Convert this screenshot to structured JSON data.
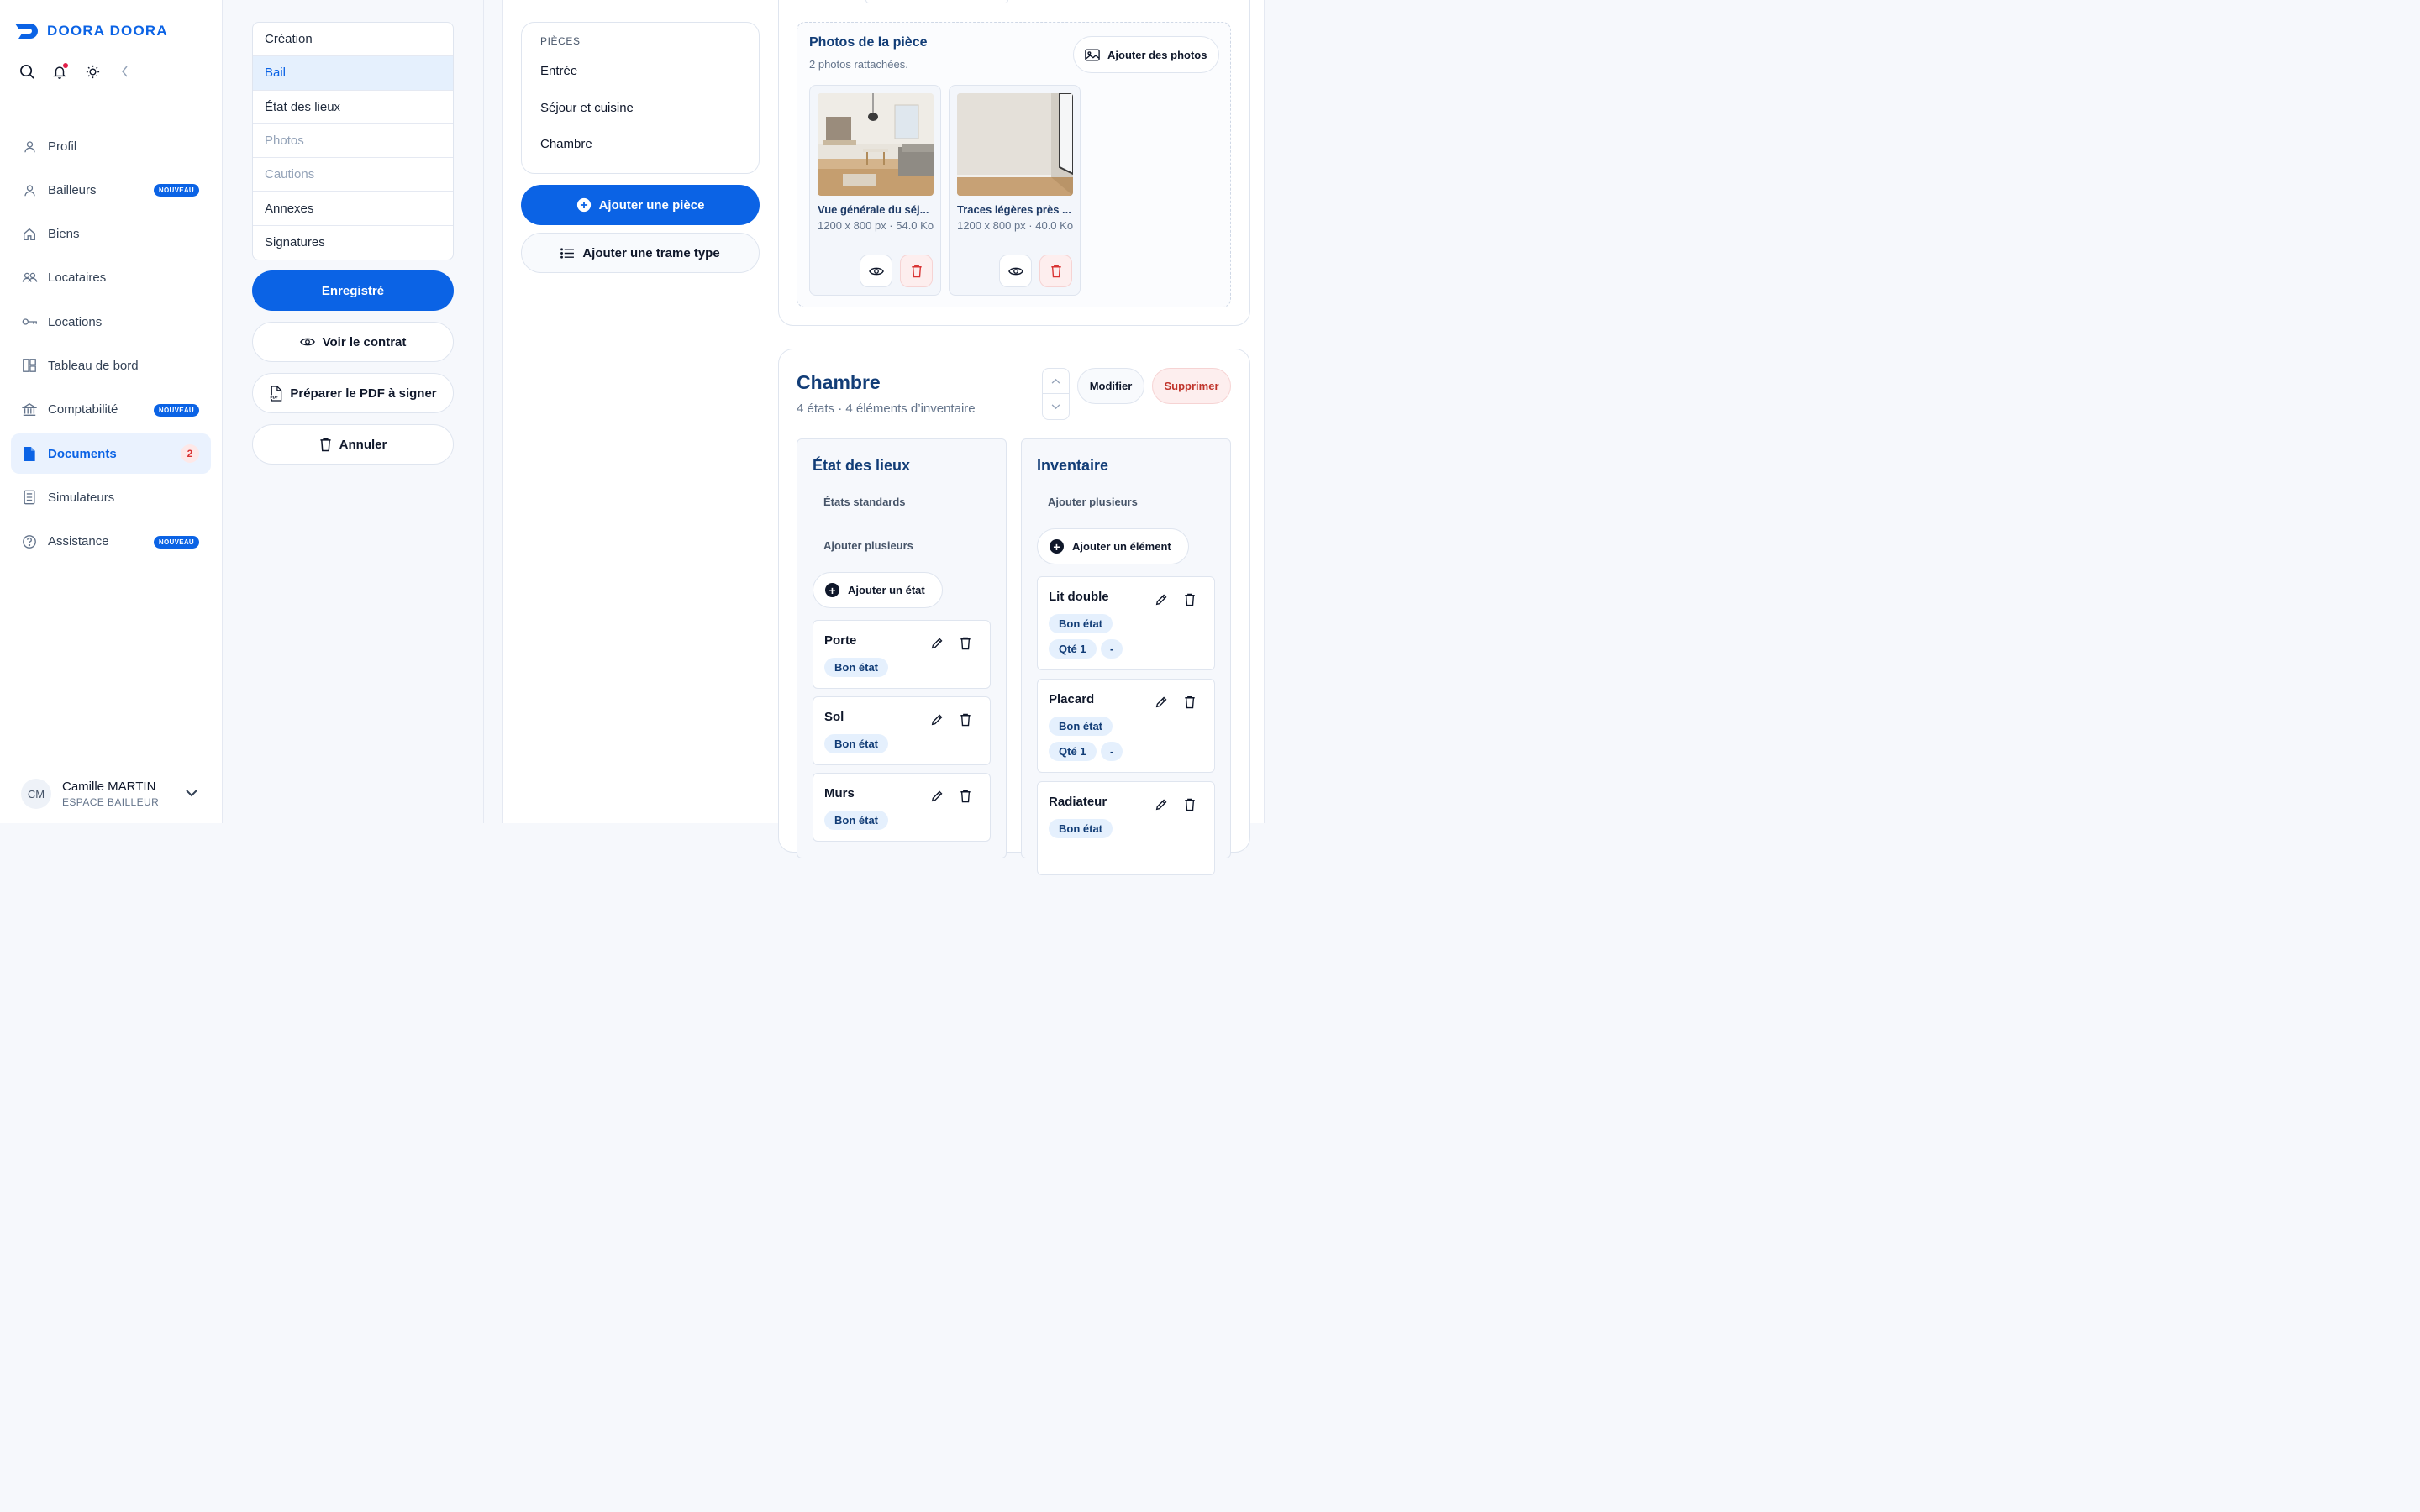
{
  "brand": {
    "name": "DOORA DOORA",
    "color": "#0b63e5"
  },
  "sidebar": {
    "top_icons": [
      "search-icon",
      "bell-icon",
      "sun-icon",
      "chevron-left-icon"
    ],
    "items": [
      {
        "label": "Profil",
        "icon": "user-icon"
      },
      {
        "label": "Bailleurs",
        "icon": "user-icon",
        "badge": "NOUVEAU"
      },
      {
        "label": "Biens",
        "icon": "home-icon"
      },
      {
        "label": "Locataires",
        "icon": "users-icon"
      },
      {
        "label": "Locations",
        "icon": "key-icon"
      },
      {
        "label": "Tableau de bord",
        "icon": "dashboard-icon"
      },
      {
        "label": "Comptabilité",
        "icon": "bank-icon",
        "badge": "NOUVEAU"
      },
      {
        "label": "Documents",
        "icon": "document-icon",
        "count": "2",
        "active": true
      },
      {
        "label": "Simulateurs",
        "icon": "calculator-icon"
      },
      {
        "label": "Assistance",
        "icon": "help-icon",
        "badge": "NOUVEAU"
      }
    ],
    "user": {
      "initials": "CM",
      "name": "Camille MARTIN",
      "role": "ESPACE BAILLEUR"
    }
  },
  "steps": [
    {
      "label": "Création"
    },
    {
      "label": "Bail",
      "active": true
    },
    {
      "label": "État des lieux"
    },
    {
      "label": "Photos",
      "disabled": true
    },
    {
      "label": "Cautions",
      "disabled": true
    },
    {
      "label": "Annexes"
    },
    {
      "label": "Signatures"
    }
  ],
  "actions": {
    "saved": "Enregistré",
    "view_contract": "Voir le contrat",
    "prepare_pdf": "Préparer le PDF à signer",
    "cancel": "Annuler"
  },
  "pieces": {
    "label": "PIÈCES",
    "items": [
      "Entrée",
      "Séjour et cuisine",
      "Chambre"
    ],
    "add_room": "Ajouter une pièce",
    "add_template": "Ajouter une trame type"
  },
  "photos": {
    "title": "Photos de la pièce",
    "subtitle": "2 photos rattachées.",
    "add_button": "Ajouter des photos",
    "items": [
      {
        "title": "Vue générale du séj...",
        "meta": "1200 x 800 px · 54.0 Ko"
      },
      {
        "title": "Traces légères près ...",
        "meta": "1200 x 800 px · 40.0 Ko"
      }
    ]
  },
  "room": {
    "title": "Chambre",
    "summary": "4 états · 4 éléments d’inventaire",
    "edit": "Modifier",
    "delete": "Supprimer",
    "etat": {
      "title": "État des lieux",
      "standard": "États standards",
      "add_multiple": "Ajouter plusieurs",
      "add_one": "Ajouter un état",
      "items": [
        {
          "name": "Porte",
          "state": "Bon état"
        },
        {
          "name": "Sol",
          "state": "Bon état"
        },
        {
          "name": "Murs",
          "state": "Bon état"
        }
      ]
    },
    "inventaire": {
      "title": "Inventaire",
      "add_multiple": "Ajouter plusieurs",
      "add_one": "Ajouter un élément",
      "items": [
        {
          "name": "Lit double",
          "state": "Bon état",
          "qty": "Qté 1",
          "extra": "-"
        },
        {
          "name": "Placard",
          "state": "Bon état",
          "qty": "Qté 1",
          "extra": "-"
        },
        {
          "name": "Radiateur",
          "state": "Bon état"
        }
      ]
    }
  }
}
